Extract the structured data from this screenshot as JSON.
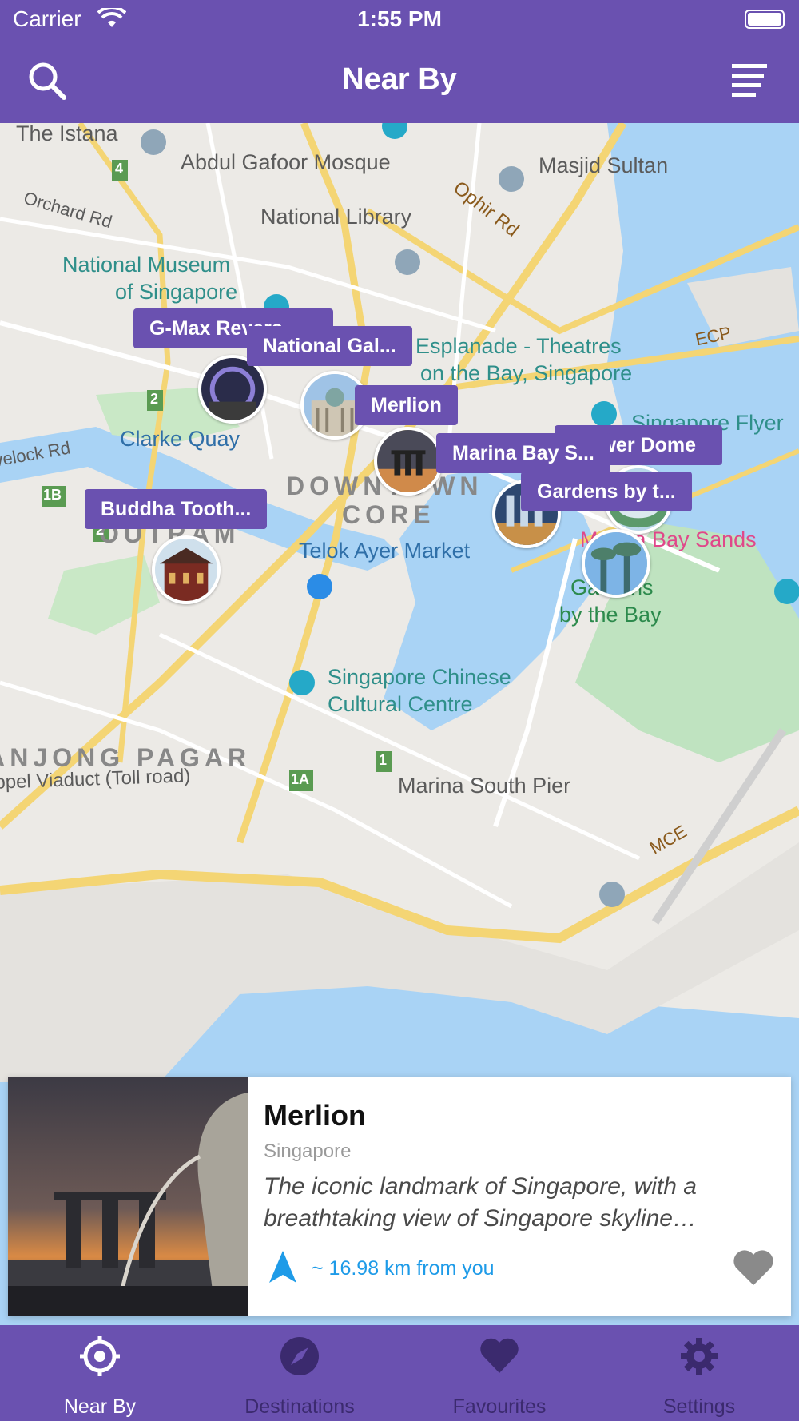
{
  "status_bar": {
    "carrier": "Carrier",
    "time": "1:55 PM"
  },
  "nav": {
    "title": "Near By",
    "search_icon": "search-icon",
    "menu_icon": "list-icon"
  },
  "map": {
    "labels": {
      "istana": "The Istana",
      "mosque": "Abdul Gafoor Mosque",
      "masjid": "Masjid Sultan",
      "ophir": "Ophir Rd",
      "orchard": "Orchard Rd",
      "library": "National Library",
      "museum1": "National Museum",
      "museum2": "of Singapore",
      "esplanade1": "Esplanade - Theatres",
      "esplanade2": "on the Bay, Singapore",
      "ecp": "ECP",
      "flyer": "Singapore Flyer",
      "clarke": "Clarke Quay",
      "havelock": "Havelock Rd",
      "downtown": "DOWNTOWN",
      "core": "CORE",
      "outram": "OUTRAM",
      "telok": "Telok Ayer Market",
      "mbs": "Marina Bay Sands",
      "gardens1": "Gardens",
      "gardens2": "by the Bay",
      "tanjong": "TANJONG PAGAR",
      "chinese1": "Singapore Chinese",
      "chinese2": "Cultural Centre",
      "viaduct": "Keppel Viaduct (Toll road)",
      "mce": "MCE",
      "pier": "Marina South Pier",
      "exit_4": "4",
      "exit_2a": "2",
      "exit_2b": "2",
      "exit_1b": "1B",
      "exit_1": "1",
      "exit_1a": "1A"
    },
    "pins": [
      {
        "name": "G-Max Revers..."
      },
      {
        "name": "National Gal..."
      },
      {
        "name": "Merlion"
      },
      {
        "name": "Marina Bay S..."
      },
      {
        "name": "Flower Dome"
      },
      {
        "name": "Gardens by t..."
      },
      {
        "name": "Buddha Tooth..."
      }
    ]
  },
  "card": {
    "name": "Merlion",
    "location": "Singapore",
    "description": "The iconic landmark of Singapore, with a breathtaking view of Singapore skyline…",
    "distance": "~ 16.98 km from you",
    "distance_icon": "location-arrow-icon",
    "favourite_icon": "heart-icon"
  },
  "tabs": [
    {
      "label": "Near By",
      "icon": "crosshair-icon",
      "active": true
    },
    {
      "label": "Destinations",
      "icon": "compass-icon",
      "active": false
    },
    {
      "label": "Favourites",
      "icon": "heart-icon",
      "active": false
    },
    {
      "label": "Settings",
      "icon": "gear-icon",
      "active": false
    }
  ],
  "colors": {
    "primary": "#6A51B0",
    "accent": "#1e9be8",
    "inactive_tab": "#3b2a6e"
  }
}
